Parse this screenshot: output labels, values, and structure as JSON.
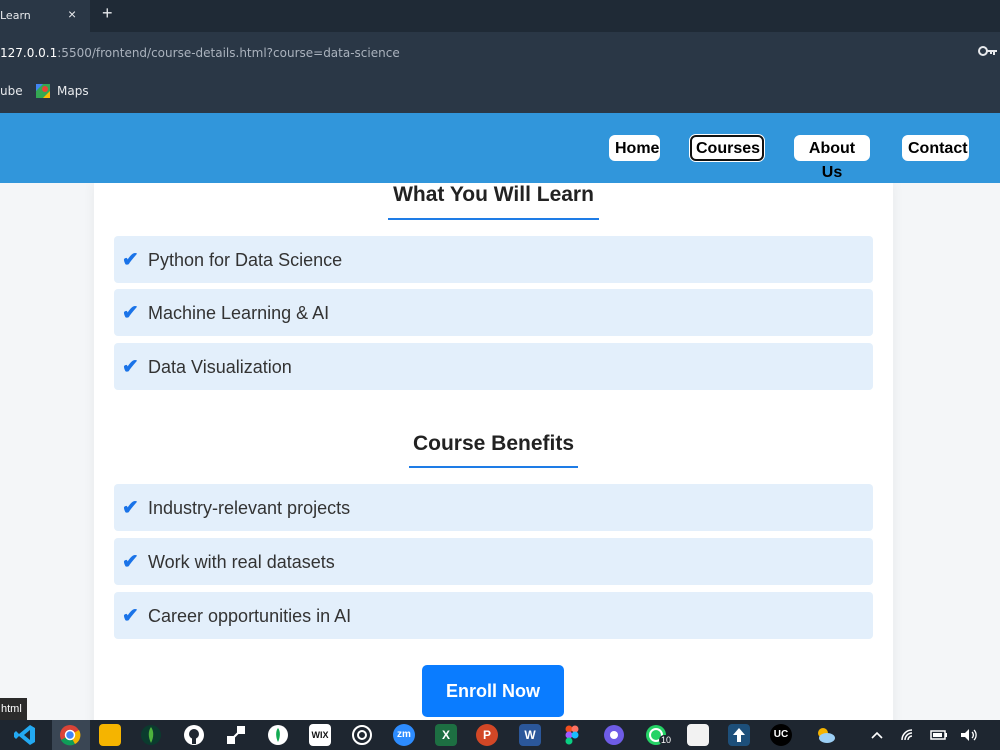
{
  "browser": {
    "tab_title": "Learn",
    "tab_close": "×",
    "new_tab": "+",
    "url_host": "127.0.0.1",
    "url_path": ":5500/frontend/course-details.html?course=data-science",
    "bookmarks": [
      "ube",
      "Maps"
    ]
  },
  "nav": {
    "links": [
      "Home",
      "Courses",
      "About Us",
      "Contact"
    ],
    "active": "Courses"
  },
  "learn": {
    "title": "What You Will Learn",
    "items": [
      "Python for Data Science",
      "Machine Learning & AI",
      "Data Visualization"
    ]
  },
  "benefits": {
    "title": "Course Benefits",
    "items": [
      "Industry-relevant projects",
      "Work with real datasets",
      "Career opportunities in AI"
    ]
  },
  "check_glyph": "✔",
  "enroll_label": "Enroll Now",
  "tooltip": "html",
  "taskbar": {
    "chrome_badge": "10",
    "wix_label": "WIX",
    "zoom_label": "zm",
    "excel_label": "X",
    "ppt_label": "P",
    "word_label": "W",
    "uc_label": "UC"
  },
  "colors": {
    "header": "#3196db",
    "accent": "#0a7cff",
    "item_bg": "#e3effb"
  }
}
